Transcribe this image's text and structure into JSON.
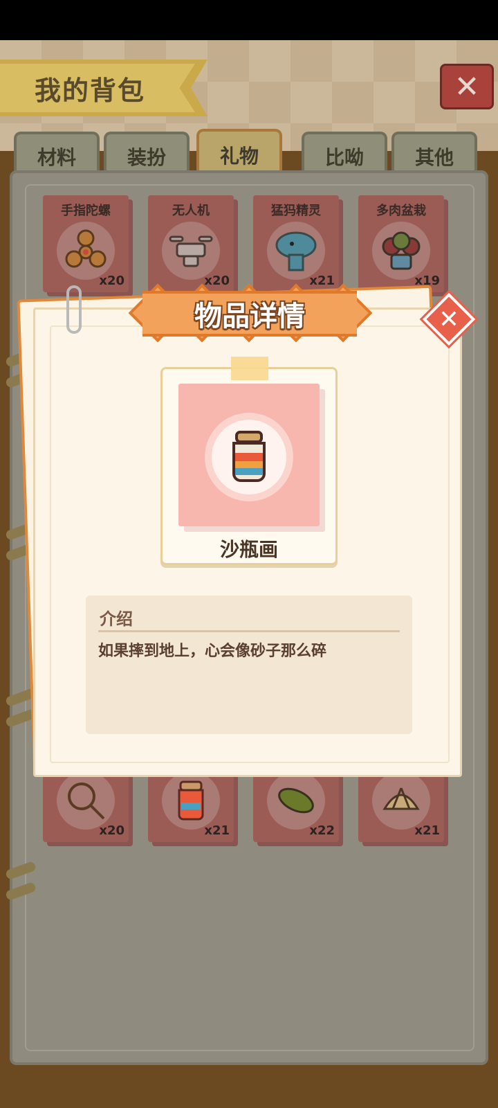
{
  "header": {
    "title": "我的背包"
  },
  "tabs": [
    {
      "label": "材料"
    },
    {
      "label": "装扮"
    },
    {
      "label": "礼物"
    },
    {
      "label": "比呦"
    },
    {
      "label": "其他"
    }
  ],
  "active_tab": "礼物",
  "items_top": [
    {
      "name": "手指陀螺",
      "qty": "x20",
      "icon": "fidget-spinner-icon"
    },
    {
      "name": "无人机",
      "qty": "x20",
      "icon": "drone-icon"
    },
    {
      "name": "猛犸精灵",
      "qty": "x21",
      "icon": "mammoth-icon"
    },
    {
      "name": "多肉盆栽",
      "qty": "x19",
      "icon": "succulent-icon"
    }
  ],
  "items_bottom": [
    {
      "qty": "x20",
      "icon": "racket-icon"
    },
    {
      "qty": "x21",
      "icon": "sand-bottle-icon"
    },
    {
      "qty": "x22",
      "icon": "leaf-icon"
    },
    {
      "qty": "x21",
      "icon": "shell-icon"
    }
  ],
  "popup": {
    "title": "物品详情",
    "item_name": "沙瓶画",
    "item_icon": "sand-bottle-icon",
    "intro_label": "介绍",
    "intro_text": "如果摔到地上，心会像砂子那么碎"
  },
  "colors": {
    "accent_orange": "#f2a25a",
    "close_red": "#e85f4a",
    "card_pink": "#f7b6ae"
  }
}
